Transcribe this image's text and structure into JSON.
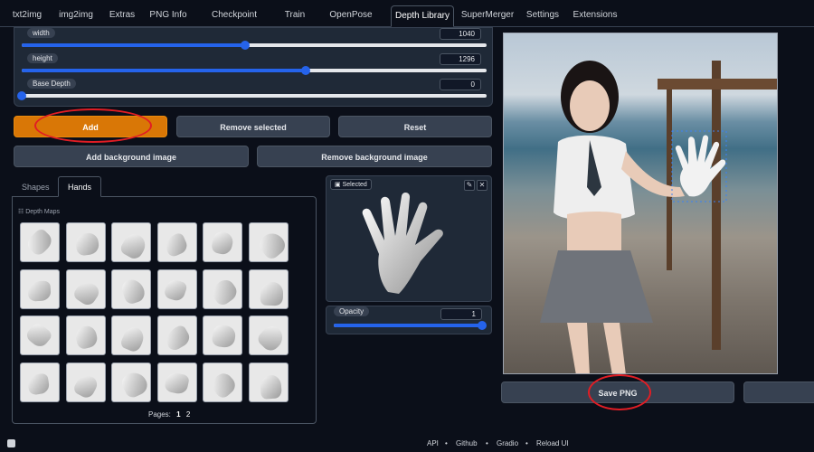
{
  "tabs": [
    {
      "label": "txt2img"
    },
    {
      "label": "img2img"
    },
    {
      "label": "Extras"
    },
    {
      "label": "PNG Info"
    },
    {
      "label": "Checkpoint Merger"
    },
    {
      "label": "Train"
    },
    {
      "label": "OpenPose Editor"
    },
    {
      "label": "Depth Library"
    },
    {
      "label": "SuperMerger"
    },
    {
      "label": "Settings"
    },
    {
      "label": "Extensions"
    }
  ],
  "active_tab": "Depth Library",
  "sliders": {
    "width": {
      "label": "width",
      "value": "1040",
      "fraction": 0.48
    },
    "height": {
      "label": "height",
      "value": "1296",
      "fraction": 0.61
    },
    "base_depth": {
      "label": "Base Depth",
      "value": "0",
      "fraction": 0.0
    }
  },
  "buttons": {
    "add": "Add",
    "remove_selected": "Remove selected",
    "reset": "Reset",
    "add_background": "Add background image",
    "remove_background": "Remove background image",
    "save_png": "Save PNG"
  },
  "library": {
    "tabs": [
      {
        "label": "Shapes"
      },
      {
        "label": "Hands"
      }
    ],
    "active_tab": "Hands",
    "section_label": "Depth Maps",
    "pages_label": "Pages:",
    "pages": [
      "1",
      "2"
    ],
    "current_page": "1"
  },
  "selected": {
    "label": "Selected",
    "edit_icon": "✎",
    "close_icon": "✕"
  },
  "opacity": {
    "label": "Opacity",
    "value": "1",
    "fraction": 1.0
  },
  "footer": {
    "links": [
      "API",
      "Github",
      "Gradio",
      "Reload UI"
    ],
    "separator": "•"
  },
  "colors": {
    "accent": "#2563eb",
    "add_button": "#d97706",
    "highlight": "#e11d24",
    "background": "#0b0f19"
  }
}
